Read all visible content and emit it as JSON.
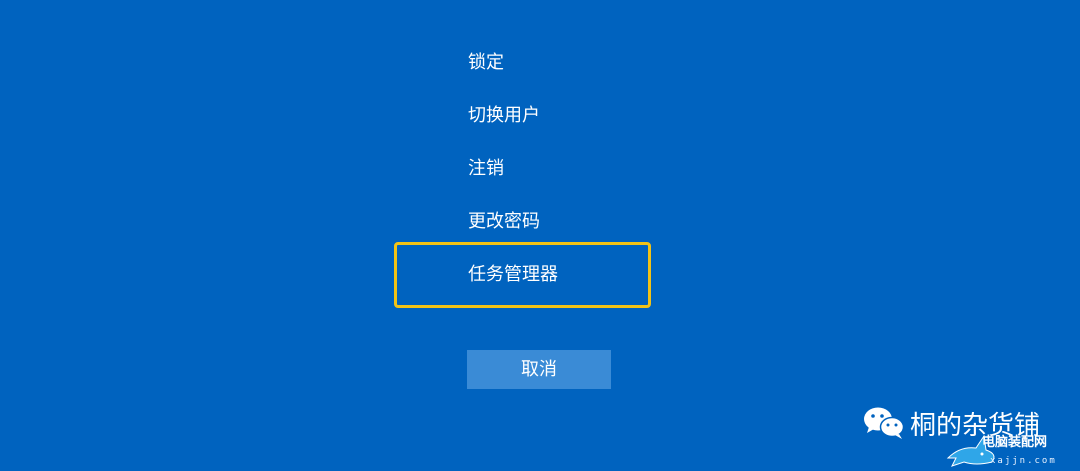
{
  "menu": {
    "items": [
      {
        "label": "锁定"
      },
      {
        "label": "切换用户"
      },
      {
        "label": "注销"
      },
      {
        "label": "更改密码"
      },
      {
        "label": "任务管理器",
        "highlighted": true
      }
    ]
  },
  "cancel": {
    "label": "取消"
  },
  "watermark": {
    "icon": "wechat-icon",
    "name": "桐的杂货铺",
    "site_name": "电脑装配网",
    "site_url": "xajjn.com"
  },
  "colors": {
    "background": "#0063bf",
    "highlight_border": "#f2c316",
    "cancel_button": "#3a8bd6",
    "text": "#ffffff"
  }
}
